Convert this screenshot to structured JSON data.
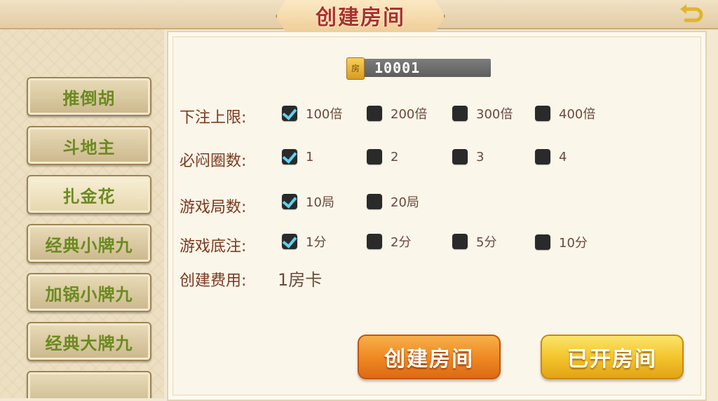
{
  "header": {
    "title": "创建房间",
    "back_icon": "back-arrow-icon"
  },
  "sidebar": {
    "items": [
      {
        "label": "推倒胡",
        "active": false
      },
      {
        "label": "斗地主",
        "active": false
      },
      {
        "label": "扎金花",
        "active": true
      },
      {
        "label": "经典小牌九",
        "active": false
      },
      {
        "label": "加锅小牌九",
        "active": false
      },
      {
        "label": "经典大牌九",
        "active": false
      }
    ]
  },
  "room": {
    "icon_label": "房",
    "number": "10001"
  },
  "settings": {
    "bet_limit": {
      "label": "下注上限:",
      "options": [
        {
          "text": "100倍",
          "checked": true
        },
        {
          "text": "200倍",
          "checked": false
        },
        {
          "text": "300倍",
          "checked": false
        },
        {
          "text": "400倍",
          "checked": false
        }
      ]
    },
    "must_stuffy": {
      "label": "必闷圈数:",
      "options": [
        {
          "text": "1",
          "checked": true
        },
        {
          "text": "2",
          "checked": false
        },
        {
          "text": "3",
          "checked": false
        },
        {
          "text": "4",
          "checked": false
        }
      ]
    },
    "rounds": {
      "label": "游戏局数:",
      "options": [
        {
          "text": "10局",
          "checked": true
        },
        {
          "text": "20局",
          "checked": false
        }
      ]
    },
    "base_bet": {
      "label": "游戏底注:",
      "options": [
        {
          "text": "1分",
          "checked": true
        },
        {
          "text": "2分",
          "checked": false
        },
        {
          "text": "5分",
          "checked": false
        },
        {
          "text": "10分",
          "checked": false
        }
      ]
    },
    "cost": {
      "label": "创建费用:",
      "value": "1房卡"
    }
  },
  "actions": {
    "create_label": "创建房间",
    "opened_label": "已开房间"
  },
  "colors": {
    "label": "#7a3a1e",
    "check": "#5fd3f0",
    "create_btn": "#ef8a23",
    "opened_btn": "#f3c52d"
  }
}
